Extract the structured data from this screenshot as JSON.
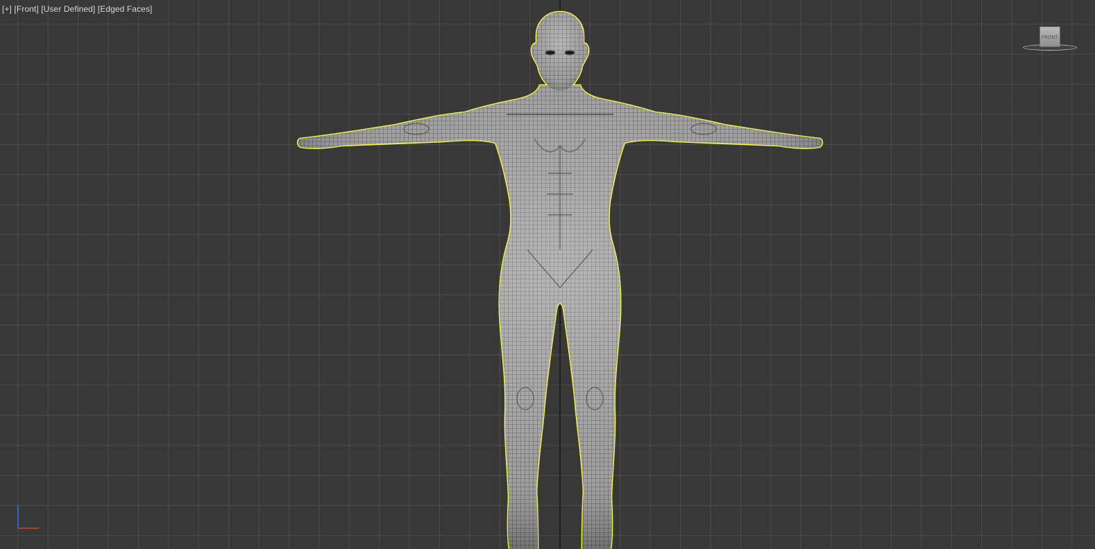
{
  "viewport": {
    "label": {
      "plus": "[+]",
      "view": "[Front]",
      "shading": "[User Defined]",
      "mode": "[Edged Faces]"
    },
    "viewcube": {
      "face": "FRONT"
    },
    "axis_tripod": {
      "axes": [
        "z",
        "x"
      ],
      "colors": {
        "z": "#3a6bff",
        "x": "#e03a2a"
      }
    }
  },
  "scene": {
    "background": "#383838",
    "grid_color": "#4e4e4e",
    "selection_color": "#ffff3c",
    "mesh_color": "#9a9a9a"
  }
}
